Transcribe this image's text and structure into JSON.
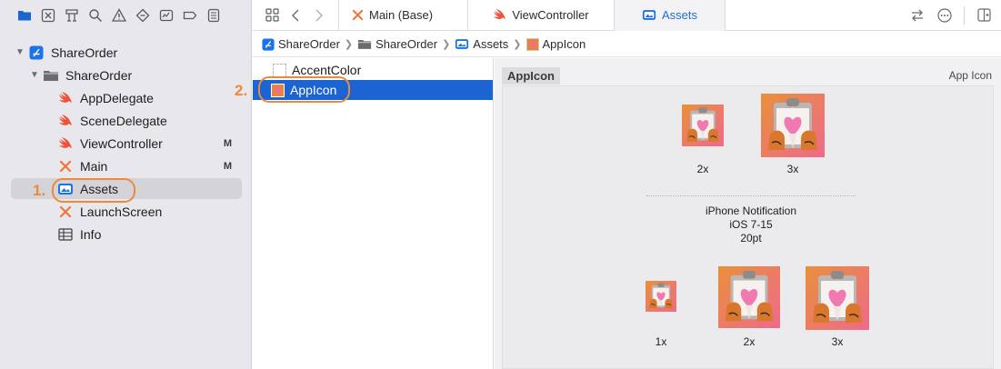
{
  "sidebar": {
    "project": {
      "label": "ShareOrder"
    },
    "group": {
      "label": "ShareOrder"
    },
    "files": [
      {
        "label": "AppDelegate",
        "kind": "swift",
        "badge": ""
      },
      {
        "label": "SceneDelegate",
        "kind": "swift",
        "badge": ""
      },
      {
        "label": "ViewController",
        "kind": "swift",
        "badge": "M"
      },
      {
        "label": "Main",
        "kind": "storyboard",
        "badge": "M"
      },
      {
        "label": "Assets",
        "kind": "assets",
        "badge": ""
      },
      {
        "label": "LaunchScreen",
        "kind": "storyboard",
        "badge": ""
      },
      {
        "label": "Info",
        "kind": "plist",
        "badge": ""
      }
    ]
  },
  "annotations": {
    "step1": "1.",
    "step2": "2.",
    "accent": "#ec8a3c"
  },
  "tabs": [
    {
      "label": "Main (Base)",
      "icon": "storyboard-icon"
    },
    {
      "label": "ViewController",
      "icon": "swift-icon"
    },
    {
      "label": "Assets",
      "icon": "assets-icon",
      "active": true
    }
  ],
  "breadcrumb": [
    "ShareOrder",
    "ShareOrder",
    "Assets",
    "AppIcon"
  ],
  "asset_list": [
    {
      "label": "AccentColor"
    },
    {
      "label": "AppIcon",
      "selected": true
    }
  ],
  "detail": {
    "set_name": "AppIcon",
    "set_type": "App Icon",
    "top_group": {
      "scales": [
        "2x",
        "3x"
      ]
    },
    "notification_group": {
      "title_lines": [
        "iPhone Notification",
        "iOS 7-15",
        "20pt"
      ],
      "scales": [
        "1x",
        "2x",
        "3x"
      ]
    }
  },
  "colors": {
    "selection": "#1d64d3",
    "active_tab": "#1f6fd6",
    "swift": "#f05138",
    "xcode_blue": "#1a73e8"
  }
}
